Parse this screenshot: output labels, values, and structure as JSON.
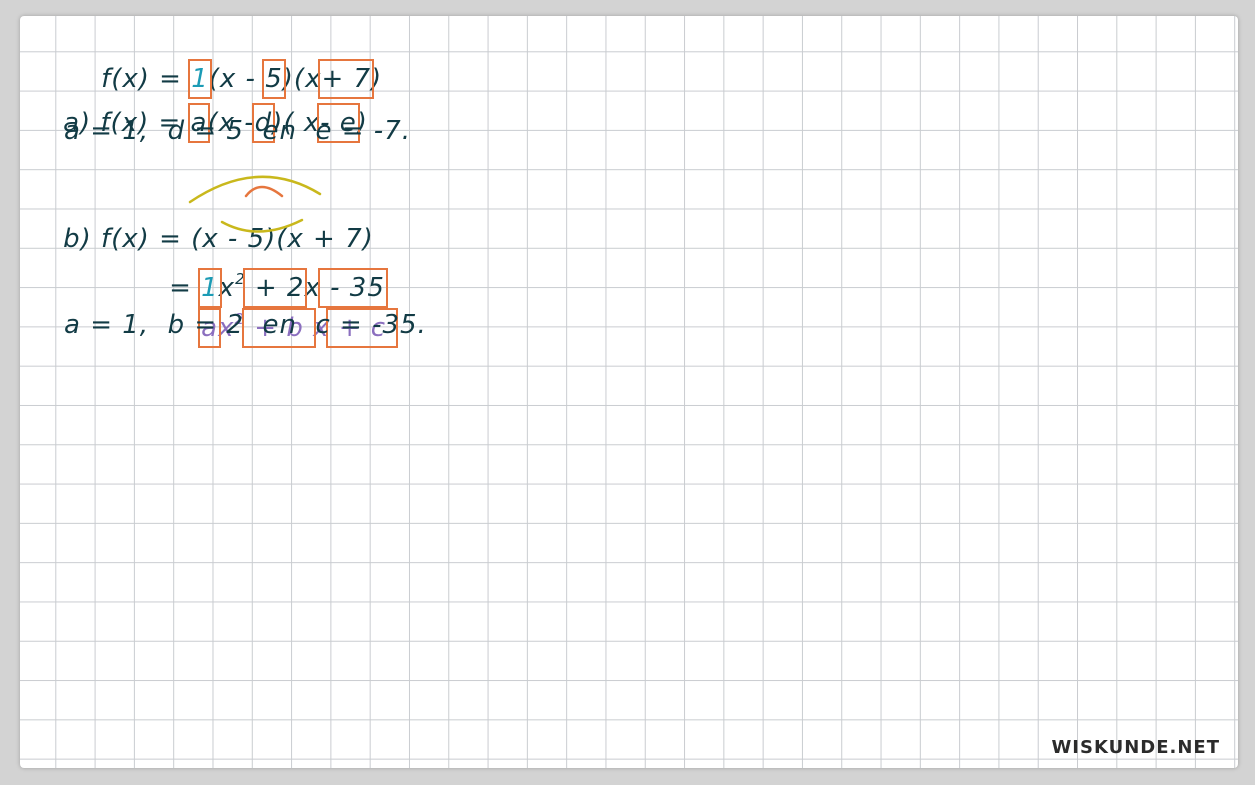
{
  "a": {
    "line1": {
      "lhs": "f(x) = ",
      "a": "1",
      "p1": "(x - ",
      "d": "5",
      "p2": ")(",
      "x": "x",
      "e": "+ 7",
      "end": ")"
    },
    "line2": {
      "label": "a)",
      "lhs": " f(x) = ",
      "a": "a",
      "p1": "(x -",
      "d": "d",
      "p2": ")( ",
      "x": "x",
      "e": "- e",
      "end": ")"
    },
    "result": "a = 1,  d = 5  en  e = -7."
  },
  "b": {
    "line1": {
      "label": "b)",
      "expr": " f(x) = (x - 5)(x + 7)"
    },
    "line2": {
      "eq": "= ",
      "a": "1",
      "x2": "x",
      "sup": "2",
      "b": " + 2",
      "x": "x",
      "c": " - 35"
    },
    "line3": {
      "a": "a",
      "x2": "x",
      "sup": "2",
      "b": " + b ",
      "x": "x",
      "c": " + c "
    },
    "result": "a = 1,  b = 2  en  c = -35."
  },
  "logo": "WISKUNDE.NET",
  "colors": {
    "ink": "#123b45",
    "teal": "#1b9bb5",
    "purple": "#8b6fbf",
    "box": "#e6763e",
    "arc_yellow": "#c9b81c",
    "arc_orange": "#e6763e"
  }
}
